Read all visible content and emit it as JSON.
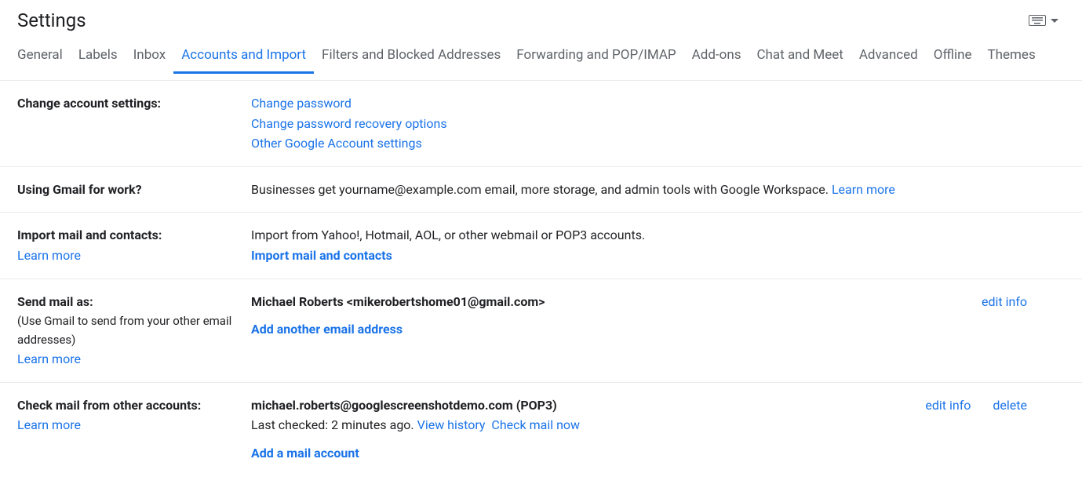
{
  "header": {
    "title": "Settings"
  },
  "tabs": {
    "items": [
      "General",
      "Labels",
      "Inbox",
      "Accounts and Import",
      "Filters and Blocked Addresses",
      "Forwarding and POP/IMAP",
      "Add-ons",
      "Chat and Meet",
      "Advanced",
      "Offline",
      "Themes"
    ],
    "activeIndex": 3
  },
  "changeAccount": {
    "label": "Change account settings:",
    "links": [
      "Change password",
      "Change password recovery options",
      "Other Google Account settings"
    ]
  },
  "usingWork": {
    "label": "Using Gmail for work?",
    "text": "Businesses get yourname@example.com email, more storage, and admin tools with Google Workspace. ",
    "learnMore": "Learn more"
  },
  "importMail": {
    "label": "Import mail and contacts:",
    "learnMore": "Learn more",
    "text": "Import from Yahoo!, Hotmail, AOL, or other webmail or POP3 accounts.",
    "action": "Import mail and contacts"
  },
  "sendMailAs": {
    "label": "Send mail as:",
    "sub": "(Use Gmail to send from your other email addresses)",
    "learnMore": "Learn more",
    "identity": "Michael Roberts <mikerobertshome01@gmail.com>",
    "addAnother": "Add another email address",
    "editInfo": "edit info"
  },
  "checkMail": {
    "label": "Check mail from other accounts:",
    "learnMore": "Learn more",
    "account": "michael.roberts@googlescreenshotdemo.com (POP3)",
    "lastChecked": "Last checked: 2 minutes ago. ",
    "viewHistory": "View history",
    "checkNow": "Check mail now",
    "addAccount": "Add a mail account",
    "editInfo": "edit info",
    "delete": "delete"
  }
}
